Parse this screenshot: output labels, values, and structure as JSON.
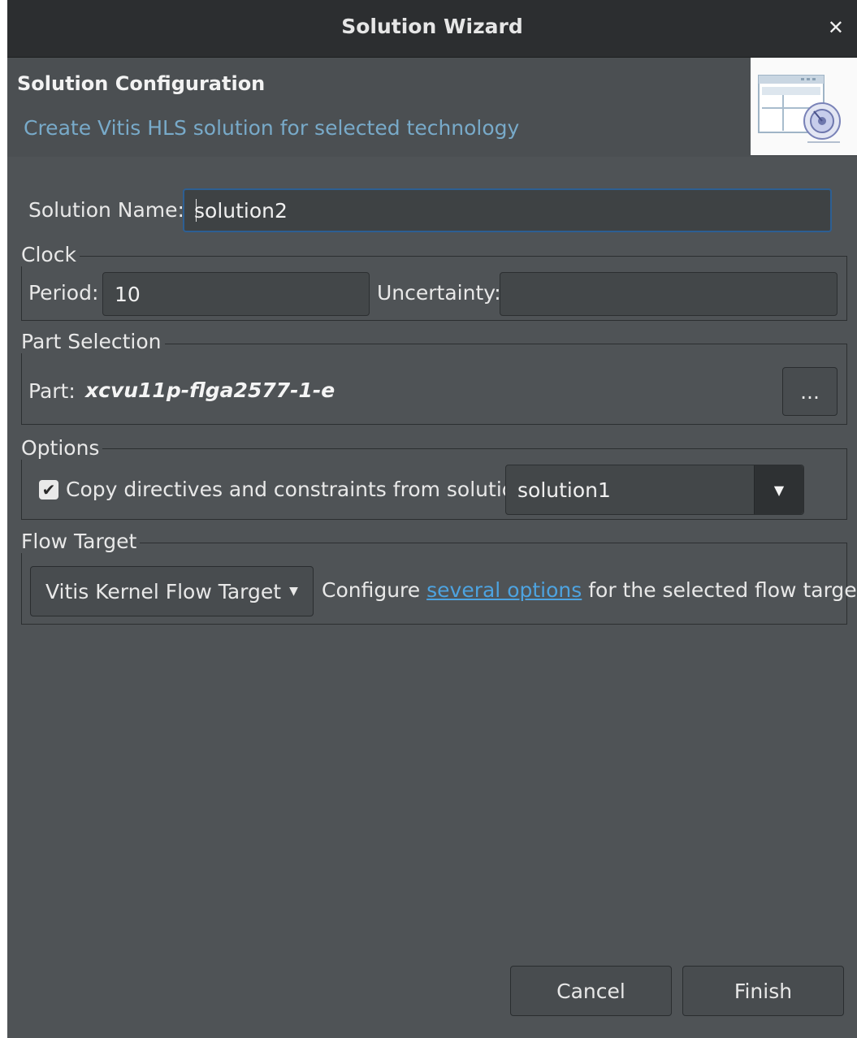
{
  "window": {
    "title": "Solution Wizard",
    "close_glyph": "✕"
  },
  "header": {
    "title": "Solution Configuration",
    "subtitle": "Create Vitis HLS solution for selected technology",
    "image_icon": "wizard-banner-icon"
  },
  "solution": {
    "name_label": "Solution Name:",
    "name_value": "solution2"
  },
  "clock": {
    "legend": "Clock",
    "period_label": "Period:",
    "period_value": "10",
    "uncertainty_label": "Uncertainty:",
    "uncertainty_value": ""
  },
  "part_selection": {
    "legend": "Part Selection",
    "part_label": "Part:",
    "part_value": "xcvu11p-flga2577-1-e",
    "browse_label": "..."
  },
  "options": {
    "legend": "Options",
    "copy_checked": true,
    "copy_label": "Copy directives and constraints from solution:",
    "copy_from_value": "solution1"
  },
  "flow_target": {
    "legend": "Flow Target",
    "selected": "Vitis Kernel Flow Target",
    "configure_prefix": "Configure",
    "configure_link": "several options",
    "configure_suffix": "for the selected flow target"
  },
  "footer": {
    "cancel_label": "Cancel",
    "finish_label": "Finish"
  },
  "colors": {
    "background": "#4f5356",
    "titlebar": "#2c2e30",
    "accent_text": "#78aac9",
    "link": "#4da3e0",
    "focus_border": "#2d5f93"
  }
}
